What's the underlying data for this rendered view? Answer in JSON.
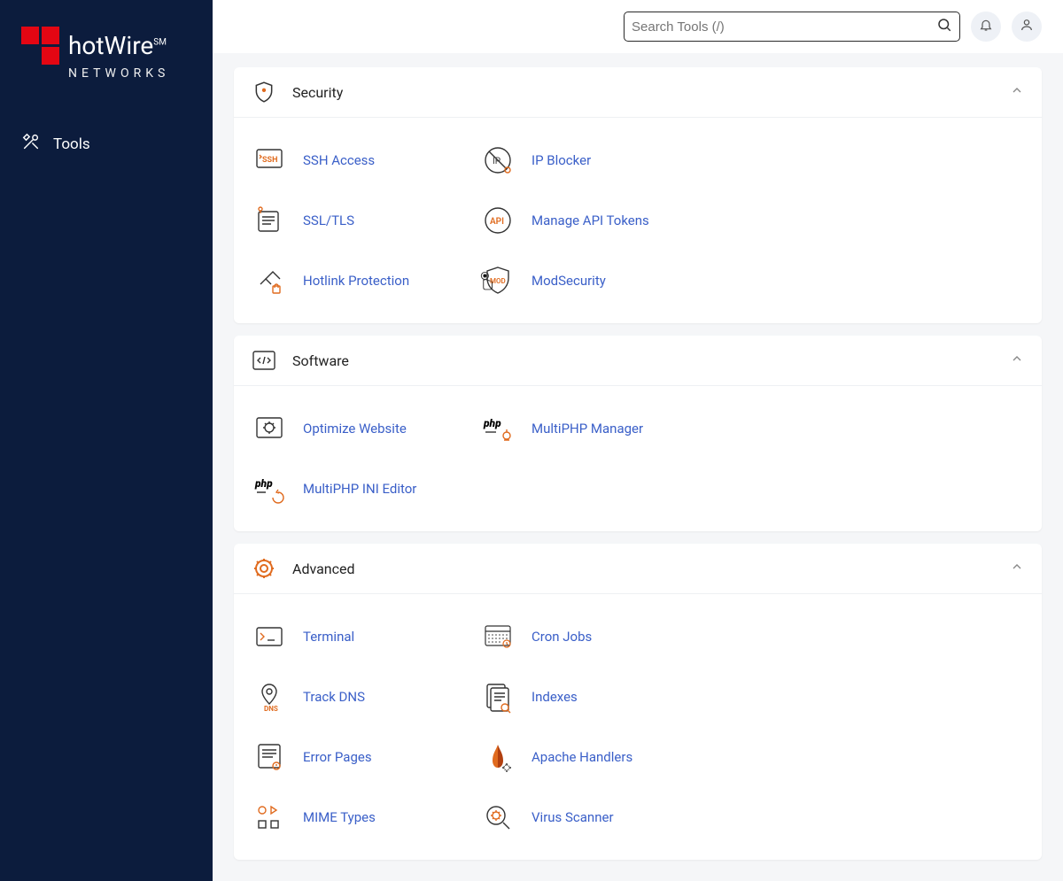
{
  "brand": {
    "line1": "hotWire",
    "line2": "NETWORKS",
    "service_mark": "SM"
  },
  "sidebar": {
    "items": [
      {
        "label": "Tools"
      }
    ]
  },
  "topbar": {
    "search_placeholder": "Search Tools (/)"
  },
  "sections": [
    {
      "title": "Security",
      "tools": [
        {
          "label": "SSH Access"
        },
        {
          "label": "IP Blocker"
        },
        {
          "label": "SSL/TLS"
        },
        {
          "label": "Manage API Tokens"
        },
        {
          "label": "Hotlink Protection"
        },
        {
          "label": "ModSecurity"
        }
      ]
    },
    {
      "title": "Software",
      "tools": [
        {
          "label": "Optimize Website"
        },
        {
          "label": "MultiPHP Manager"
        },
        {
          "label": "MultiPHP INI Editor"
        }
      ]
    },
    {
      "title": "Advanced",
      "tools": [
        {
          "label": "Terminal"
        },
        {
          "label": "Cron Jobs"
        },
        {
          "label": "Track DNS"
        },
        {
          "label": "Indexes"
        },
        {
          "label": "Error Pages"
        },
        {
          "label": "Apache Handlers"
        },
        {
          "label": "MIME Types"
        },
        {
          "label": "Virus Scanner"
        }
      ]
    }
  ]
}
